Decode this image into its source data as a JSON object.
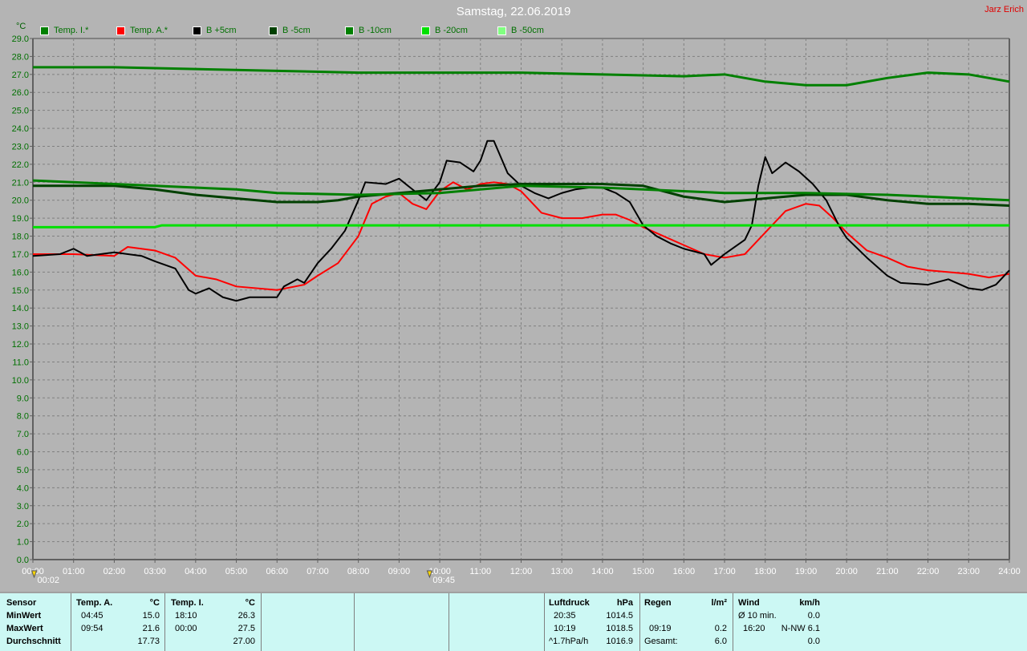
{
  "title": "Samstag, 22.06.2019",
  "author": "Jarz Erich",
  "markers": [
    {
      "time": "00:02",
      "hour": 0.03
    },
    {
      "time": "09:45",
      "hour": 9.75
    }
  ],
  "chart_data": {
    "type": "line",
    "unit": "°C",
    "ylim": [
      0,
      29
    ],
    "xlim": [
      0,
      24
    ],
    "y_ticks": [
      "0.0",
      "1.0",
      "2.0",
      "3.0",
      "4.0",
      "5.0",
      "6.0",
      "7.0",
      "8.0",
      "9.0",
      "10.0",
      "11.0",
      "12.0",
      "13.0",
      "14.0",
      "15.0",
      "16.0",
      "17.0",
      "18.0",
      "19.0",
      "20.0",
      "21.0",
      "22.0",
      "23.0",
      "24.0",
      "25.0",
      "26.0",
      "27.0",
      "28.0",
      "29.0"
    ],
    "x_ticks": [
      "00:00",
      "01:00",
      "02:00",
      "03:00",
      "04:00",
      "05:00",
      "06:00",
      "07:00",
      "08:00",
      "09:00",
      "10:00",
      "11:00",
      "12:00",
      "13:00",
      "14:00",
      "15:00",
      "16:00",
      "17:00",
      "18:00",
      "19:00",
      "20:00",
      "21:00",
      "22:00",
      "23:00",
      "24:00"
    ],
    "grid": true,
    "series": [
      {
        "name": "Temp. I.*",
        "color": "#008000",
        "x": [
          0,
          2,
          4,
          6,
          8,
          10,
          12,
          14,
          16,
          17,
          18,
          19,
          20,
          21,
          22,
          23,
          24
        ],
        "y": [
          27.4,
          27.4,
          27.3,
          27.2,
          27.1,
          27.1,
          27.1,
          27.0,
          26.9,
          27.0,
          26.6,
          26.4,
          26.4,
          26.8,
          27.1,
          27.0,
          26.6
        ]
      },
      {
        "name": "Temp. A.*",
        "color": "#ff0000",
        "x": [
          0,
          1,
          2,
          2.33,
          3,
          3.5,
          4,
          4.5,
          5,
          6,
          6.67,
          7,
          7.5,
          8,
          8.33,
          8.67,
          9,
          9.33,
          9.67,
          10,
          10.33,
          10.67,
          11,
          11.33,
          11.67,
          12,
          12.5,
          13,
          13.5,
          14,
          14.33,
          14.67,
          15,
          15.5,
          16,
          16.5,
          17,
          17.5,
          18,
          18.5,
          19,
          19.33,
          19.67,
          20,
          20.5,
          21,
          21.5,
          22,
          23,
          23.5,
          24
        ],
        "y": [
          17.0,
          17.0,
          16.9,
          17.4,
          17.2,
          16.8,
          15.8,
          15.6,
          15.2,
          15.0,
          15.3,
          15.8,
          16.5,
          18.0,
          19.8,
          20.2,
          20.4,
          19.8,
          19.5,
          20.5,
          21.0,
          20.6,
          20.9,
          21.0,
          20.9,
          20.5,
          19.3,
          19.0,
          19.0,
          19.2,
          19.2,
          18.9,
          18.5,
          18.0,
          17.5,
          17.0,
          16.8,
          17.0,
          18.2,
          19.4,
          19.8,
          19.7,
          19.0,
          18.2,
          17.2,
          16.8,
          16.3,
          16.1,
          15.9,
          15.7,
          15.9
        ]
      },
      {
        "name": "B +5cm",
        "color": "#000000",
        "x": [
          0,
          0.67,
          1,
          1.33,
          2,
          2.67,
          3,
          3.5,
          3.83,
          4,
          4.33,
          4.67,
          5,
          5.33,
          6,
          6.17,
          6.5,
          6.67,
          7,
          7.33,
          7.67,
          8,
          8.17,
          8.67,
          9,
          9.33,
          9.67,
          10,
          10.17,
          10.5,
          10.83,
          11,
          11.17,
          11.33,
          11.67,
          12,
          12.33,
          12.67,
          13,
          13.33,
          13.67,
          14,
          14.33,
          14.67,
          15,
          15.33,
          15.67,
          16,
          16.5,
          16.67,
          17,
          17.5,
          17.67,
          17.83,
          18,
          18.17,
          18.5,
          18.83,
          19.17,
          19.5,
          19.83,
          20,
          20.5,
          21,
          21.33,
          22,
          22.5,
          23,
          23.33,
          23.67,
          24
        ],
        "y": [
          16.9,
          17.0,
          17.3,
          16.9,
          17.1,
          16.9,
          16.6,
          16.2,
          15.0,
          14.8,
          15.1,
          14.6,
          14.4,
          14.6,
          14.6,
          15.2,
          15.6,
          15.4,
          16.5,
          17.3,
          18.3,
          20.0,
          21.0,
          20.9,
          21.2,
          20.6,
          20.0,
          21.0,
          22.2,
          22.1,
          21.6,
          22.2,
          23.3,
          23.3,
          21.5,
          20.8,
          20.4,
          20.1,
          20.4,
          20.6,
          20.7,
          20.7,
          20.4,
          19.9,
          18.6,
          18.0,
          17.6,
          17.3,
          17.0,
          16.4,
          17.0,
          17.8,
          18.6,
          20.8,
          22.4,
          21.5,
          22.1,
          21.6,
          20.9,
          20.0,
          18.5,
          17.9,
          16.8,
          15.8,
          15.4,
          15.3,
          15.6,
          15.1,
          15.0,
          15.3,
          16.1
        ]
      },
      {
        "name": "B -5cm",
        "color": "#004000",
        "x": [
          0,
          2,
          3,
          4,
          5,
          6,
          7,
          7.5,
          8,
          9,
          10,
          11,
          12,
          14,
          15,
          16,
          17,
          18,
          19,
          20,
          21,
          22,
          23,
          24
        ],
        "y": [
          20.8,
          20.8,
          20.6,
          20.3,
          20.1,
          19.9,
          19.9,
          20.0,
          20.2,
          20.4,
          20.6,
          20.8,
          20.9,
          20.9,
          20.8,
          20.2,
          19.9,
          20.1,
          20.3,
          20.3,
          20.0,
          19.8,
          19.8,
          19.7
        ]
      },
      {
        "name": "B -10cm",
        "color": "#008000",
        "x": [
          0,
          2,
          4,
          5,
          6,
          8,
          10,
          11,
          12,
          14,
          15,
          16,
          17,
          19,
          21,
          22,
          24
        ],
        "y": [
          21.1,
          20.9,
          20.7,
          20.6,
          20.4,
          20.3,
          20.4,
          20.6,
          20.8,
          20.7,
          20.6,
          20.5,
          20.4,
          20.4,
          20.3,
          20.2,
          20.0
        ]
      },
      {
        "name": "B -20cm",
        "color": "#00e000",
        "x": [
          0,
          3,
          3.17,
          24
        ],
        "y": [
          18.5,
          18.5,
          18.6,
          18.6
        ]
      },
      {
        "name": "B -50cm",
        "color": "#80ff80",
        "x": [],
        "y": []
      }
    ]
  },
  "panel": {
    "sensor": {
      "h": "Sensor",
      "rows": [
        "MinWert",
        "MaxWert",
        "Durchschnitt"
      ]
    },
    "tempA": {
      "h": "Temp. A.",
      "u": "°C",
      "min_t": "04:45",
      "min_v": "15.0",
      "max_t": "09:54",
      "max_v": "21.6",
      "avg": "17.73"
    },
    "tempI": {
      "h": "Temp. I.",
      "u": "°C",
      "min_t": "18:10",
      "min_v": "26.3",
      "max_t": "00:00",
      "max_v": "27.5",
      "avg": "27.00"
    },
    "druck": {
      "h": "Luftdruck",
      "u": "hPa",
      "min_t": "20:35",
      "min_v": "1014.5",
      "max_t": "10:19",
      "max_v": "1018.5",
      "trend": "^1.7hPa/h",
      "avg": "1016.9"
    },
    "regen": {
      "h": "Regen",
      "u": "l/m²",
      "t": "09:19",
      "v": "0.2",
      "gl": "Gesamt:",
      "gv": "6.0"
    },
    "wind": {
      "h": "Wind",
      "u": "km/h",
      "l1": "Ø 10 min.",
      "v1": "0.0",
      "t2": "16:20",
      "v2": "N-NW 6.1",
      "v3": "0.0"
    }
  }
}
